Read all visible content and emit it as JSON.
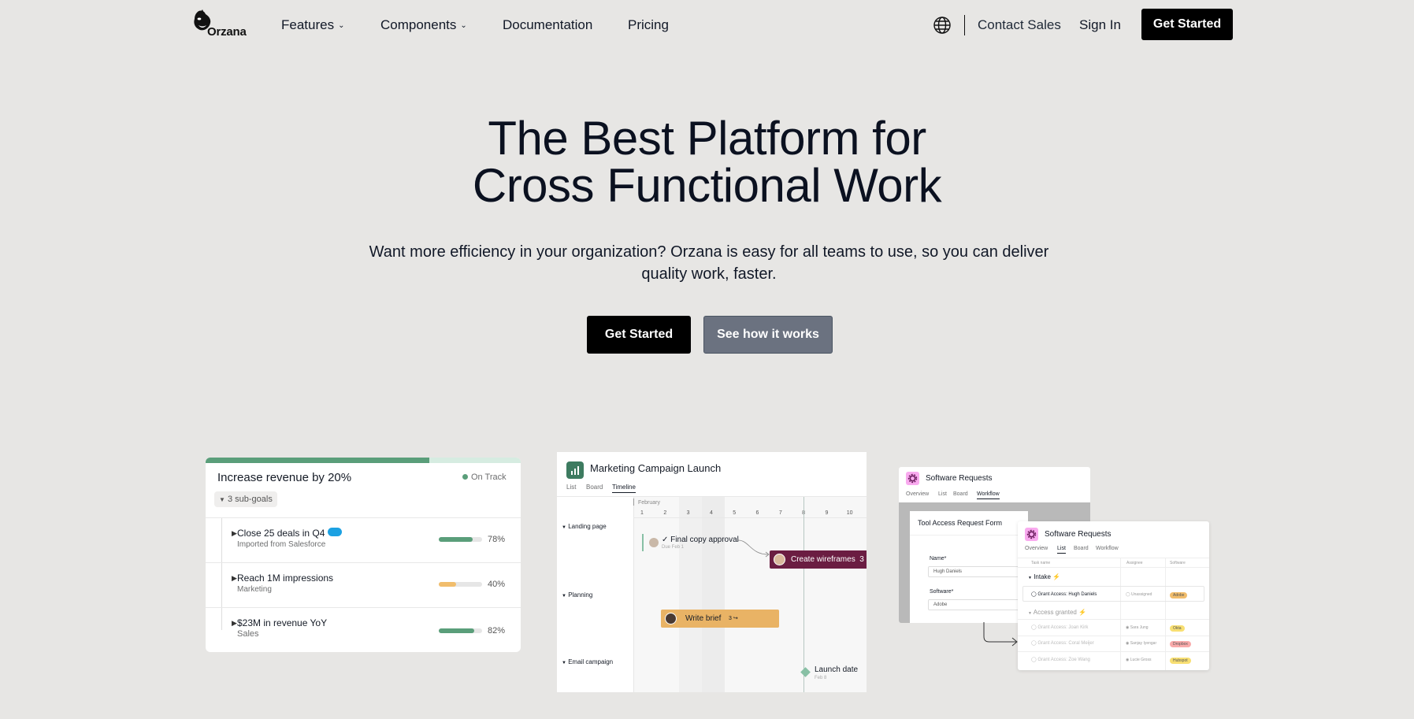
{
  "nav": {
    "logo_text": "Orzana",
    "items": [
      {
        "label": "Features",
        "has_dropdown": true
      },
      {
        "label": "Components",
        "has_dropdown": true
      },
      {
        "label": "Documentation",
        "has_dropdown": false
      },
      {
        "label": "Pricing",
        "has_dropdown": false
      }
    ],
    "globe_icon": "globe-icon",
    "contact_sales": "Contact Sales",
    "sign_in": "Sign In",
    "get_started": "Get Started"
  },
  "hero": {
    "title_line1": "The Best Platform for",
    "title_line2": "Cross Functional Work",
    "subtitle_line1": "Want more efficiency in your organization? Orzana is easy for all teams to use, so you can deliver",
    "subtitle_line2": "quality work, faster.",
    "primary_button": "Get Started",
    "secondary_button": "See how it works"
  },
  "goals_card": {
    "title": "Increase revenue by 20%",
    "status": "On Track",
    "overall_progress": 0.71,
    "subgoals_label": "3 sub-goals",
    "goals": [
      {
        "name": "Close 25 deals in Q4",
        "sub": "Imported from Salesforce",
        "progress": 78,
        "percent_label": "78%",
        "color": "#5a9e7a",
        "salesforce_badge": true
      },
      {
        "name": "Reach 1M impressions",
        "sub": "Marketing",
        "progress": 40,
        "percent_label": "40%",
        "color": "#f1bd6c",
        "salesforce_badge": false
      },
      {
        "name": "$23M in revenue YoY",
        "sub": "Sales",
        "progress": 82,
        "percent_label": "82%",
        "color": "#5a9e7a",
        "salesforce_badge": false
      }
    ]
  },
  "timeline_card": {
    "title": "Marketing Campaign Launch",
    "tabs": [
      {
        "label": "List",
        "active": false
      },
      {
        "label": "Board",
        "active": false
      },
      {
        "label": "Timeline",
        "active": true
      }
    ],
    "month": "February",
    "days": [
      "1",
      "2",
      "3",
      "4",
      "5",
      "6",
      "7",
      "8",
      "9",
      "10"
    ],
    "sections": [
      "Landing page",
      "Planning",
      "Email campaign"
    ],
    "tasks": {
      "final_copy": {
        "name": "Final copy approval",
        "due": "Due Feb 1"
      },
      "wireframes": {
        "name": "Create wireframes",
        "count": "3"
      },
      "brief": {
        "name": "Write brief",
        "count": "3"
      }
    },
    "milestone": {
      "name": "Launch date",
      "date": "Feb 8"
    }
  },
  "requests_back": {
    "title": "Software Requests",
    "tabs": [
      {
        "label": "Overview",
        "active": false
      },
      {
        "label": "List",
        "active": false
      },
      {
        "label": "Board",
        "active": false
      },
      {
        "label": "Workflow",
        "active": true
      }
    ],
    "form_title": "Tool Access Request Form",
    "name_label": "Name*",
    "name_value": "Hugh Daniels",
    "software_label": "Software*",
    "software_value": "Adobe"
  },
  "requests_front": {
    "title": "Software Requests",
    "tabs": [
      {
        "label": "Overview",
        "active": false
      },
      {
        "label": "List",
        "active": true
      },
      {
        "label": "Board",
        "active": false
      },
      {
        "label": "Workflow",
        "active": false
      }
    ],
    "columns": [
      "Task name",
      "Assignee",
      "Software"
    ],
    "group_intake": "Intake",
    "group_granted": "Access granted",
    "intake_rows": [
      {
        "name": "Grant Access: Hugh Daniels",
        "assignee": "Unassigned",
        "software": "Adobe",
        "pill_color": "#f1bd6c"
      }
    ],
    "granted_rows": [
      {
        "name": "Grant Access: Joan Kirk",
        "assignee": "Sara Jung",
        "software": "Okta",
        "pill_color": "#f8df72"
      },
      {
        "name": "Grant Access: Coral Meijer",
        "assignee": "Sanjay Iyengar",
        "software": "Dropbox",
        "pill_color": "#f9aaaa"
      },
      {
        "name": "Grant Access: Zoe Wang",
        "assignee": "Lucie Gross",
        "software": "Hubspot",
        "pill_color": "#f8df72"
      }
    ]
  }
}
